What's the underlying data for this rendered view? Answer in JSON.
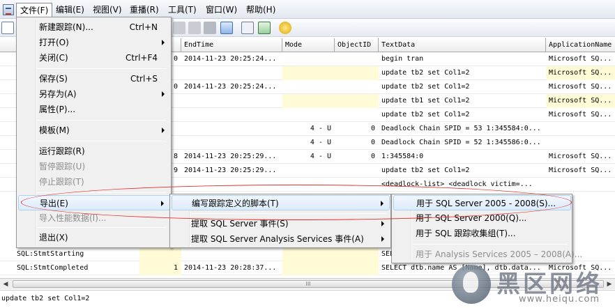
{
  "menubar": {
    "items": [
      "文件(F)",
      "编辑(E)",
      "视图(V)",
      "重播(R)",
      "工具(T)",
      "窗口(W)",
      "帮助(H)"
    ]
  },
  "grid": {
    "headers": [
      "EndTime",
      "Mode",
      "ObjectID",
      "TextData",
      "ApplicationName"
    ],
    "rows": [
      {
        "a": "0",
        "end": "2014-11-23 20:25:24...",
        "mode": "",
        "obj": "",
        "text": "begin tran",
        "app": "Microsoft SQ...",
        "y": false
      },
      {
        "a": "",
        "end": "",
        "mode": "",
        "obj": "",
        "text": "update tb2 set Col1=2",
        "app": "Microsoft SQ...",
        "y": true
      },
      {
        "a": "0",
        "end": "2014-11-23 20:25:24...",
        "mode": "",
        "obj": "",
        "text": "update tb2 set Col1=2",
        "app": "Microsoft SQ...",
        "y": false
      },
      {
        "a": "",
        "end": "",
        "mode": "",
        "obj": "",
        "text": "update tb1 set Col1=2",
        "app": "Microsoft SQ...",
        "y": true
      },
      {
        "a": "",
        "end": "",
        "mode": "",
        "obj": "",
        "text": "update tb2 set Col1=2",
        "app": "Microsoft SQ...",
        "y": false
      },
      {
        "a": "",
        "end": "",
        "mode": "4 - U",
        "obj": "0",
        "text": "Deadlock Chain SPID = 53 1:345584:0...",
        "app": "",
        "y": false
      },
      {
        "a": "",
        "end": "",
        "mode": "4 - U",
        "obj": "0",
        "text": "Deadlock Chain SPID = 52 1:345586:0...",
        "app": "",
        "y": false
      },
      {
        "a": "8",
        "end": "2014-11-23 20:25:29...",
        "mode": "4 - U",
        "obj": "0",
        "text": "1:345584:0",
        "app": "Microsoft SQ...",
        "y": false
      },
      {
        "a": "9",
        "end": "2014-11-23 20:25:29...",
        "mode": "",
        "obj": "",
        "text": "update tb2 set Col1=2",
        "app": "Microsoft SQ...",
        "y": false
      },
      {
        "a": "",
        "end": "",
        "mode": "",
        "obj": "",
        "text": "<deadlock-list>  <deadlock victim=...",
        "app": "",
        "y": false
      }
    ],
    "bottom_rows": [
      {
        "event": "SQL:StmtStarting",
        "a": "",
        "end": "",
        "text": "SELE",
        "app": ""
      },
      {
        "event": "SQL:StmtCompleted",
        "a": "1",
        "end": "2014-11-23 20:28:37...",
        "text": "SELECT dtb.name AS [Name], dtb.data...",
        "app": "Microsoft SQ..."
      }
    ]
  },
  "file_menu": {
    "items": [
      {
        "label": "新建跟踪(N)...",
        "shortcut": "Ctrl+N"
      },
      {
        "label": "打开(O)",
        "submenu": true
      },
      {
        "label": "关闭(C)",
        "shortcut": "Ctrl+F4"
      },
      {
        "label": "保存(S)",
        "shortcut": "Ctrl+S"
      },
      {
        "label": "另存为(A)",
        "submenu": true
      },
      {
        "label": "属性(P)..."
      },
      {
        "label": "模板(M)",
        "submenu": true
      },
      {
        "label": "运行跟踪(R)"
      },
      {
        "label": "暂停跟踪(U)",
        "disabled": true
      },
      {
        "label": "停止跟踪(T)",
        "disabled": true
      },
      {
        "label": "导出(E)",
        "submenu": true
      },
      {
        "label": "导入性能数据(I)...",
        "disabled": true
      },
      {
        "label": "退出(X)"
      }
    ]
  },
  "export_menu": {
    "items": [
      {
        "label": "编写跟踪定义的脚本(T)"
      },
      {
        "label": "提取 SQL Server 事件(S)"
      },
      {
        "label": "提取 SQL Server Analysis Services 事件(A)"
      }
    ]
  },
  "script_menu": {
    "items": [
      {
        "label": "用于 SQL Server 2005 - 2008(S)..."
      },
      {
        "label": "用于 SQL Server 2000(Q)..."
      },
      {
        "label": "用于 SQL 跟踪收集组(T)..."
      },
      {
        "label": "用于 Analysis Services 2005 – 2008(A)...",
        "disabled": true
      }
    ]
  },
  "scrollbar": {
    "grip": "III"
  },
  "detail": {
    "text": "update tb2 set Col1=2"
  },
  "watermark": {
    "cn": "黑区网络",
    "url": "www.heiqu.com"
  },
  "colors": {
    "highlight_border": "#a8d2f8",
    "annotation": "#e4312b",
    "yellow_row": "#fffbd6"
  }
}
